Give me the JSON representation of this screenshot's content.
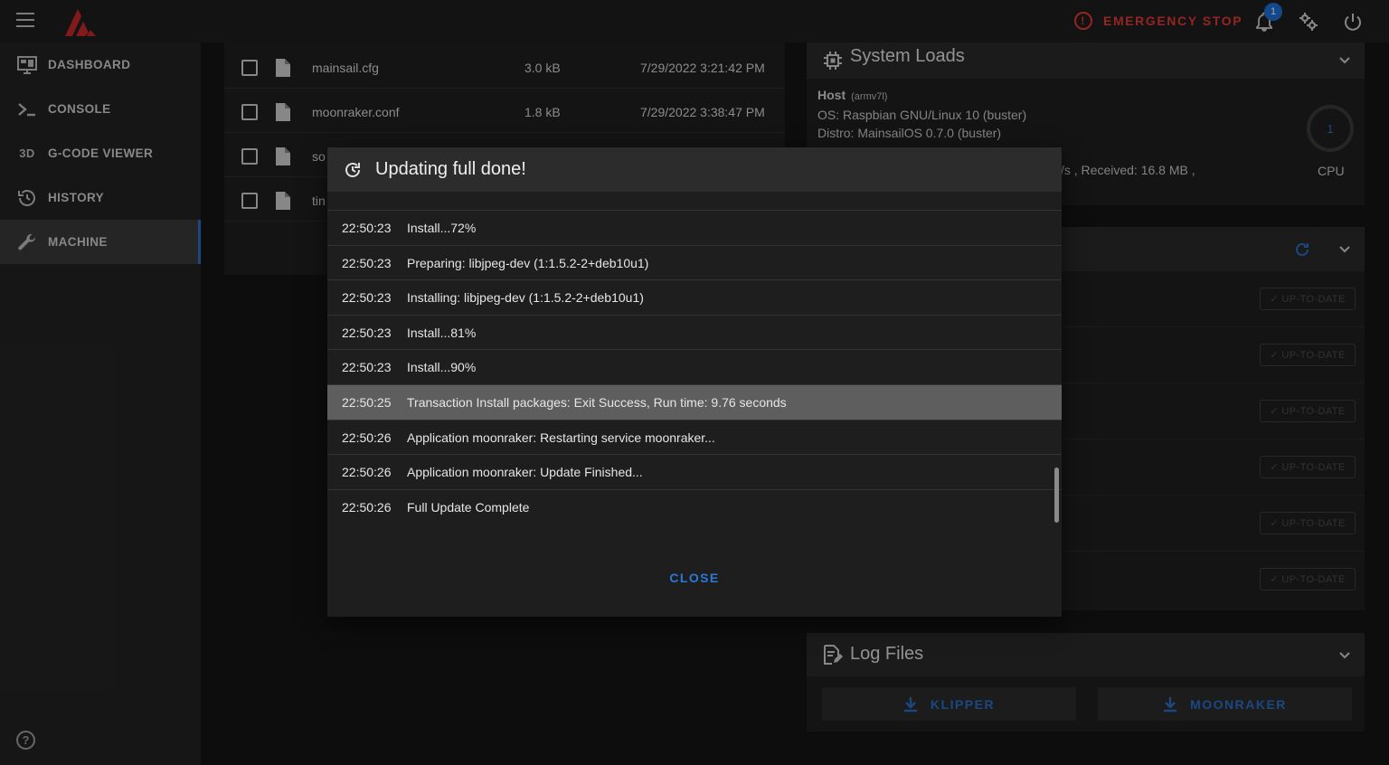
{
  "topbar": {
    "emergency_stop_label": "EMERGENCY STOP",
    "notification_count": "1",
    "icons": [
      "menu-icon",
      "logo",
      "alert-circle-icon",
      "bell-icon",
      "cogs-icon",
      "power-icon"
    ],
    "accent_red": "#e53935",
    "accent_blue": "#1e6fd8"
  },
  "sidebar": {
    "items": [
      {
        "label": "DASHBOARD",
        "icon": "monitor-dashboard-icon"
      },
      {
        "label": "CONSOLE",
        "icon": "console-icon"
      },
      {
        "label": "G-CODE VIEWER",
        "icon": "3d-icon",
        "icon_text": "3D"
      },
      {
        "label": "HISTORY",
        "icon": "history-icon"
      },
      {
        "label": "MACHINE",
        "icon": "wrench-icon",
        "active": true
      }
    ],
    "help_icon": "?"
  },
  "files": {
    "rows": [
      {
        "name": "mainsail.cfg",
        "size": "3.0 kB",
        "modified": "7/29/2022 3:21:42 PM"
      },
      {
        "name": "moonraker.conf",
        "size": "1.8 kB",
        "modified": "7/29/2022 3:38:47 PM"
      },
      {
        "name": "so",
        "size": "",
        "modified": ""
      },
      {
        "name": "tin",
        "size": "",
        "modified": ""
      }
    ]
  },
  "system_loads": {
    "title": "System Loads",
    "host_label": "Host",
    "host_arch": "(armv7l)",
    "os_line": "OS: Raspbian GNU/Linux 10 (buster)",
    "distro_line": "Distro: MainsailOS 0.7.0 (buster)",
    "network_line": "/s , Received: 16.8 MB ,",
    "cpu_value": "1",
    "cpu_label": "CPU"
  },
  "update_manager": {
    "status_labels": [
      "UP-TO-DATE",
      "UP-TO-DATE",
      "UP-TO-DATE",
      "UP-TO-DATE",
      "UP-TO-DATE",
      "UP-TO-DATE"
    ]
  },
  "log_files": {
    "title": "Log Files",
    "buttons": [
      "KLIPPER",
      "MOONRAKER"
    ]
  },
  "dialog": {
    "title": "Updating full done!",
    "close_label": "CLOSE",
    "log": [
      {
        "time": "22:50:23",
        "message": "Install...72%"
      },
      {
        "time": "22:50:23",
        "message": "Preparing: libjpeg-dev (1:1.5.2-2+deb10u1)"
      },
      {
        "time": "22:50:23",
        "message": "Installing: libjpeg-dev (1:1.5.2-2+deb10u1)"
      },
      {
        "time": "22:50:23",
        "message": "Install...81%"
      },
      {
        "time": "22:50:23",
        "message": "Install...90%"
      },
      {
        "time": "22:50:25",
        "message": "Transaction Install packages: Exit Success, Run time: 9.76 seconds"
      },
      {
        "time": "22:50:26",
        "message": "Application moonraker: Restarting service moonraker..."
      },
      {
        "time": "22:50:26",
        "message": "Application moonraker: Update Finished..."
      },
      {
        "time": "22:50:26",
        "message": "Full Update Complete"
      }
    ]
  }
}
